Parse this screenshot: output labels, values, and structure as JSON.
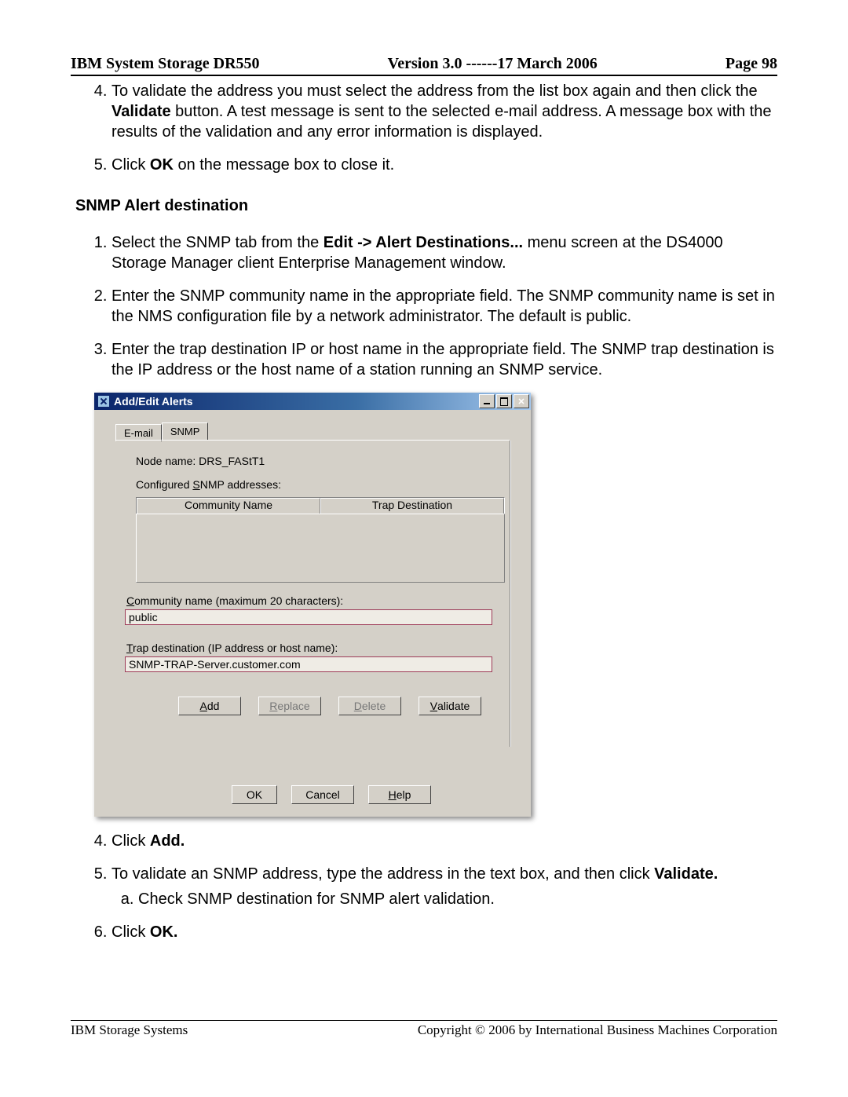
{
  "header": {
    "left": "IBM System Storage DR550",
    "center": "Version 3.0 ------17 March 2006",
    "right": "Page 98"
  },
  "p4": {
    "a": "To validate the address you must select the address from the list box again and then click the ",
    "b": "Validate",
    "c": " button. A test message is sent to the selected e-mail address. A message box with the results of the validation and any error information is displayed."
  },
  "p5": {
    "a": "Click ",
    "b": "OK",
    "c": " on the message box to close it."
  },
  "section": "SNMP Alert destination",
  "s1": {
    "a": "Select the SNMP tab from the ",
    "b": "Edit -> Alert Destinations...",
    "c": " menu screen at the DS4000 Storage Manager client Enterprise Management window."
  },
  "s2": "Enter the SNMP community name in the appropriate field. The SNMP community name is set in the NMS configuration file by a network administrator. The default is public.",
  "s3": "Enter the trap destination IP or host name in the appropriate field. The SNMP trap destination is the IP address or the host name of a station running an SNMP service.",
  "s4": {
    "a": "Click ",
    "b": "Add."
  },
  "s5": {
    "a": "To validate an SNMP address, type the address in the text box, and then click ",
    "b": "Validate."
  },
  "s5a": "Check SNMP destination for SNMP alert validation.",
  "s6": {
    "a": "Click ",
    "b": "OK."
  },
  "footer": {
    "left": "IBM Storage Systems",
    "right": "Copyright © 2006 by International Business Machines Corporation"
  },
  "dialog": {
    "title": "Add/Edit Alerts",
    "tabs": {
      "email": "E-mail",
      "snmp": "SNMP"
    },
    "node_label": "Node name: DRS_FAStT1",
    "configured_label_pre": "Configured ",
    "configured_label_u": "S",
    "configured_label_post": "NMP addresses:",
    "col1": "Community Name",
    "col2": "Trap Destination",
    "community_label_pre": "",
    "community_label_u": "C",
    "community_label_post": "ommunity name (maximum 20 characters):",
    "community_value": "public",
    "trap_label_pre": "",
    "trap_label_u": "T",
    "trap_label_post": "rap destination (IP address or host name):",
    "trap_value": "SNMP-TRAP-Server.customer.com",
    "btn_add_u": "A",
    "btn_add": "dd",
    "btn_replace_u": "R",
    "btn_replace": "eplace",
    "btn_delete_u": "D",
    "btn_delete": "elete",
    "btn_validate_u": "V",
    "btn_validate": "alidate",
    "btn_ok": "OK",
    "btn_cancel": "Cancel",
    "btn_help_u": "H",
    "btn_help": "elp"
  }
}
